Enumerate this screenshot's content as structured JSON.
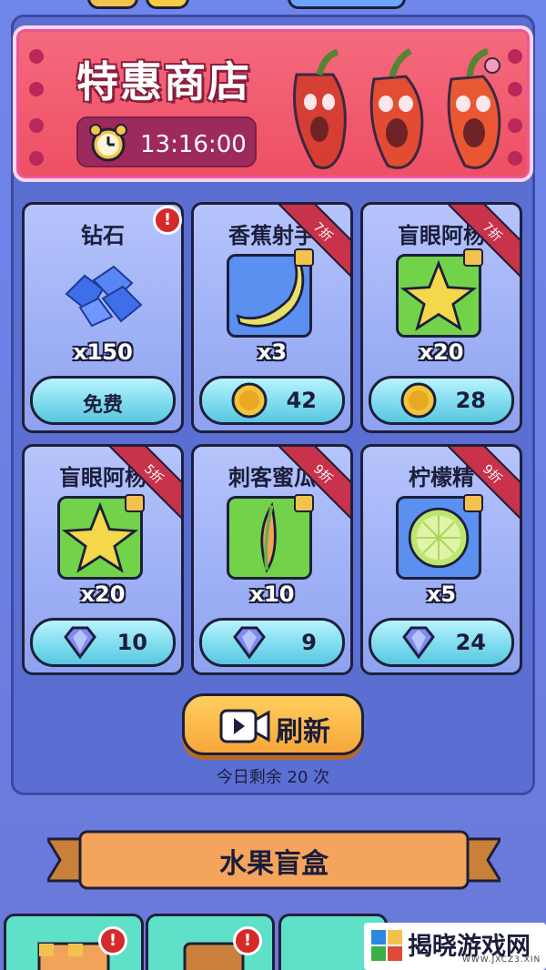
{
  "shop": {
    "title": "特惠商店",
    "countdown": "13:16:00",
    "items": [
      {
        "name": "钻石",
        "qty": "x150",
        "price_label": "免费",
        "currency": "free",
        "discount": "",
        "alert": "!"
      },
      {
        "name": "香蕉射手",
        "qty": "x3",
        "price": "42",
        "currency": "coin",
        "discount": "7折"
      },
      {
        "name": "盲眼阿杨",
        "qty": "x20",
        "price": "28",
        "currency": "coin",
        "discount": "7折"
      },
      {
        "name": "盲眼阿杨",
        "qty": "x20",
        "price": "10",
        "currency": "diamond",
        "discount": "5折"
      },
      {
        "name": "刺客蜜瓜",
        "qty": "x10",
        "price": "9",
        "currency": "diamond",
        "discount": "9折"
      },
      {
        "name": "柠檬精",
        "qty": "x5",
        "price": "24",
        "currency": "diamond",
        "discount": "9折"
      }
    ]
  },
  "refresh": {
    "label": "刷新",
    "remaining_text": "今日剩余 20 次"
  },
  "section": {
    "title": "水果盲盒"
  },
  "bottom_nav": {
    "alerts": [
      "!",
      "!"
    ]
  },
  "watermark": {
    "text": "揭晓游戏网",
    "url": "WWW.JXCZ3.XIN"
  },
  "colors": {
    "background": "#6c7fe3",
    "banner": "#ee4f63",
    "buy_button": "#7fdcef",
    "refresh_button": "#f7a63a",
    "ribbon": "#c8324a"
  }
}
